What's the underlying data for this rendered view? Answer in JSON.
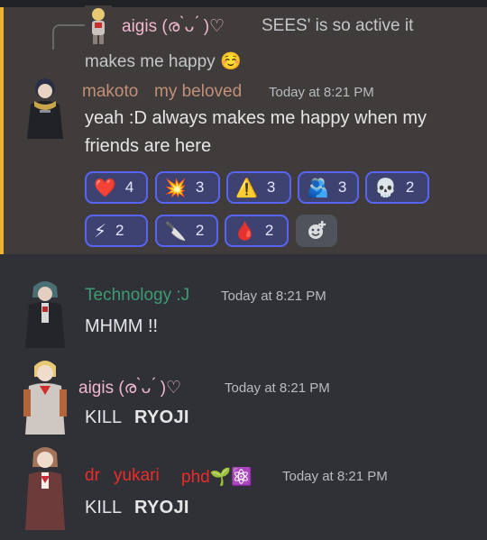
{
  "reply": {
    "author": "aigis (ര ̀ᴗ ́ )♡",
    "preview_line1": "SEES' is so active it",
    "preview_line2": "makes me happy ☺️"
  },
  "messages": [
    {
      "author_first": "makoto",
      "author_second": "my beloved",
      "author_color": "#c28f78",
      "timestamp": "Today at 8:21 PM",
      "line1": "yeah :D always makes me happy when my",
      "line2": "friends are here"
    },
    {
      "author": "Technology :J",
      "author_color": "#3e9b74",
      "timestamp": "Today at 8:21 PM",
      "text": "MHMM !!"
    },
    {
      "author": "aigis (ര ̀ᴗ ́ )♡",
      "author_color": "#f2b8cf",
      "timestamp": "Today at 8:21 PM",
      "text_a": "KILL",
      "text_b": "RYOJI"
    },
    {
      "author_first": "dr",
      "author_second": "yukari",
      "author_third": "phd🌱⚛️",
      "author_color": "#ed2b2b",
      "timestamp": "Today at 8:21 PM",
      "text_a": "KILL",
      "text_b": "RYOJI"
    }
  ],
  "reactions": [
    {
      "emoji": "❤️",
      "count": "4",
      "icon": "heart-icon"
    },
    {
      "emoji": "💥",
      "count": "3",
      "icon": "collision-icon"
    },
    {
      "emoji": "⚠️",
      "count": "3",
      "icon": "warning-icon"
    },
    {
      "emoji": "🫂",
      "count": "3",
      "icon": "people-hugging-icon"
    },
    {
      "emoji": "💀",
      "count": "2",
      "icon": "skull-icon"
    },
    {
      "emoji": "⚡",
      "count": "2",
      "icon": "lightning-icon"
    },
    {
      "emoji": "🔪",
      "count": "2",
      "icon": "knife-icon"
    },
    {
      "emoji": "🩸",
      "count": "2",
      "icon": "blood-drop-icon"
    }
  ],
  "colors": {
    "highlight_bar": "#f0b232",
    "reaction_border": "#5865f2",
    "background": "#2f3136"
  }
}
